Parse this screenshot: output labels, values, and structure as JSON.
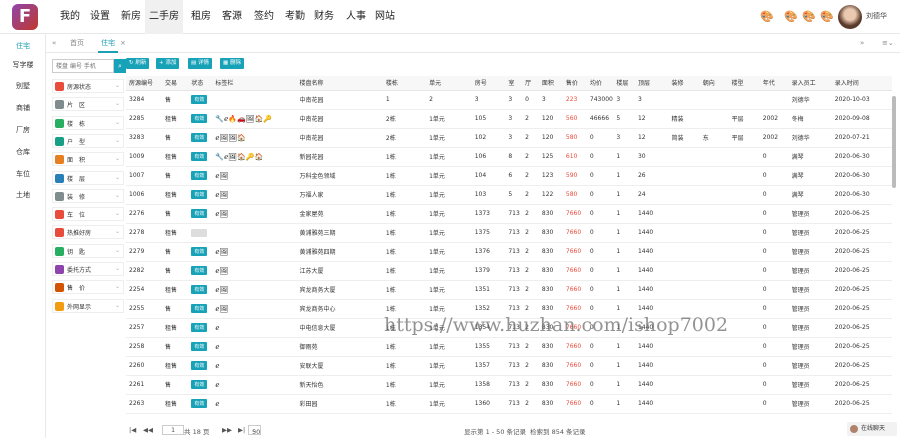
{
  "nav": {
    "logo": "F",
    "items": [
      "我的",
      "设置",
      "新房",
      "二手房",
      "租房",
      "客源",
      "签约",
      "考勤",
      "财务",
      "人事",
      "网站"
    ],
    "active_index": 3,
    "user": "刘德华"
  },
  "leftmenu": {
    "items": [
      "住宅",
      "写字楼",
      "别墅",
      "商铺",
      "厂房",
      "仓库",
      "车位",
      "土地"
    ],
    "active_index": 0
  },
  "tabs": {
    "first": "首页",
    "active": "住宅"
  },
  "filter": {
    "search_placeholder": "楼盘 编号 手机",
    "rows": [
      {
        "label": "房源状态",
        "color": "#e74c3c"
      },
      {
        "label": "片　区",
        "color": "#7f8c8d"
      },
      {
        "label": "楼　栋",
        "color": "#27ae60"
      },
      {
        "label": "户　型",
        "color": "#16a085"
      },
      {
        "label": "面　积",
        "color": "#e67e22"
      },
      {
        "label": "楼　层",
        "color": "#2980b9"
      },
      {
        "label": "装　修",
        "color": "#7f8c8d"
      },
      {
        "label": "车　位",
        "color": "#e74c3c"
      },
      {
        "label": "热推好房",
        "color": "#e74c3c"
      },
      {
        "label": "钥　匙",
        "color": "#27ae60"
      },
      {
        "label": "委托方式",
        "color": "#8e44ad"
      },
      {
        "label": "售　价",
        "color": "#d35400"
      },
      {
        "label": "外网显示",
        "color": "#f39c12"
      }
    ]
  },
  "toolbar": {
    "buttons": [
      "刷新",
      "添加",
      "详情",
      "删除"
    ]
  },
  "table": {
    "headers": [
      "房源编号",
      "交易",
      "状态",
      "标签栏",
      "楼盘名称",
      "楼栋",
      "单元",
      "房号",
      "室",
      "厅",
      "面积",
      "售价",
      "均价",
      "楼层",
      "顶层",
      "装修",
      "朝向",
      "楼型",
      "年代",
      "录入员工",
      "录入时间"
    ],
    "rows": [
      [
        "3284",
        "售",
        "有效",
        "",
        "中南花园",
        "1",
        "2",
        "3",
        "3",
        "0",
        "3",
        "223",
        "743000",
        "3",
        "3",
        "",
        "",
        "",
        "",
        "刘德华",
        "2020-10-03"
      ],
      [
        "2285",
        "租售",
        "有效",
        "🔧ℯ🔥🚗🖼🏠🔑",
        "中南花园",
        "2栋",
        "1单元",
        "105",
        "3",
        "2",
        "120",
        "560",
        "46666",
        "5",
        "12",
        "精装",
        "",
        "平层",
        "2002",
        "冬梅",
        "2020-09-08"
      ],
      [
        "3283",
        "售",
        "有效",
        "ℯ🖼🖼🏠",
        "中南花园",
        "2栋",
        "1单元",
        "102",
        "3",
        "2",
        "120",
        "580",
        "0",
        "3",
        "12",
        "简装",
        "东",
        "平层",
        "2002",
        "刘德华",
        "2020-07-21"
      ],
      [
        "1009",
        "租售",
        "有效",
        "🔧ℯ🖼🏠🔑🏠",
        "新园花园",
        "1栋",
        "1单元",
        "106",
        "8",
        "2",
        "125",
        "610",
        "0",
        "1",
        "30",
        "",
        "",
        "",
        "0",
        "满琴",
        "2020-06-30"
      ],
      [
        "1007",
        "售",
        "有效",
        "ℯ🖼",
        "万科金色领域",
        "1栋",
        "1单元",
        "104",
        "6",
        "2",
        "123",
        "590",
        "0",
        "1",
        "26",
        "",
        "",
        "",
        "0",
        "满琴",
        "2020-06-30"
      ],
      [
        "1006",
        "租售",
        "有效",
        "ℯ🖼",
        "万福人家",
        "1栋",
        "1单元",
        "103",
        "5",
        "2",
        "122",
        "580",
        "0",
        "1",
        "24",
        "",
        "",
        "",
        "0",
        "满琴",
        "2020-06-30"
      ],
      [
        "2276",
        "售",
        "有效",
        "ℯ🖼",
        "金家屋苑",
        "1栋",
        "1单元",
        "1373",
        "713",
        "2",
        "830",
        "7660",
        "0",
        "1",
        "1440",
        "",
        "",
        "",
        "0",
        "管理员",
        "2020-06-25"
      ],
      [
        "2278",
        "租售",
        "",
        "",
        "黄浦雅苑三期",
        "1栋",
        "1单元",
        "1375",
        "713",
        "2",
        "830",
        "7660",
        "0",
        "1",
        "1440",
        "",
        "",
        "",
        "0",
        "管理员",
        "2020-06-25"
      ],
      [
        "2279",
        "售",
        "有效",
        "ℯ🖼",
        "黄浦雅苑四期",
        "1栋",
        "1单元",
        "1376",
        "713",
        "2",
        "830",
        "7660",
        "0",
        "1",
        "1440",
        "",
        "",
        "",
        "0",
        "管理员",
        "2020-06-25"
      ],
      [
        "2282",
        "售",
        "有效",
        "ℯ🖼",
        "江苏大厦",
        "1栋",
        "1单元",
        "1379",
        "713",
        "2",
        "830",
        "7660",
        "0",
        "1",
        "1440",
        "",
        "",
        "",
        "0",
        "管理员",
        "2020-06-25"
      ],
      [
        "2254",
        "租售",
        "有效",
        "ℯ🖼",
        "宾龙商务大厦",
        "1栋",
        "1单元",
        "1351",
        "713",
        "2",
        "830",
        "7660",
        "0",
        "1",
        "1440",
        "",
        "",
        "",
        "0",
        "管理员",
        "2020-06-25"
      ],
      [
        "2255",
        "售",
        "有效",
        "ℯ🖼",
        "宾龙商务中心",
        "1栋",
        "1单元",
        "1352",
        "713",
        "2",
        "830",
        "7660",
        "0",
        "1",
        "1440",
        "",
        "",
        "",
        "0",
        "管理员",
        "2020-06-25"
      ],
      [
        "2257",
        "租售",
        "有效",
        "ℯ",
        "中电信息大厦",
        "1栋",
        "1单元",
        "1354",
        "713",
        "2",
        "830",
        "7660",
        "0",
        "1",
        "1440",
        "",
        "",
        "",
        "0",
        "管理员",
        "2020-06-25"
      ],
      [
        "2258",
        "售",
        "有效",
        "ℯ",
        "御雨苑",
        "1栋",
        "1单元",
        "1355",
        "713",
        "2",
        "830",
        "7660",
        "0",
        "1",
        "1440",
        "",
        "",
        "",
        "0",
        "管理员",
        "2020-06-25"
      ],
      [
        "2260",
        "租售",
        "有效",
        "ℯ",
        "安联大厦",
        "1栋",
        "1单元",
        "1357",
        "713",
        "2",
        "830",
        "7660",
        "0",
        "1",
        "1440",
        "",
        "",
        "",
        "0",
        "管理员",
        "2020-06-25"
      ],
      [
        "2261",
        "售",
        "有效",
        "ℯ",
        "新天怡色",
        "1栋",
        "1单元",
        "1358",
        "713",
        "2",
        "830",
        "7660",
        "0",
        "1",
        "1440",
        "",
        "",
        "",
        "0",
        "管理员",
        "2020-06-25"
      ],
      [
        "2263",
        "租售",
        "有效",
        "ℯ",
        "彩田园",
        "1栋",
        "1单元",
        "1360",
        "713",
        "2",
        "830",
        "7660",
        "0",
        "1",
        "1440",
        "",
        "",
        "",
        "0",
        "管理员",
        "2020-06-25"
      ]
    ]
  },
  "pager": {
    "page": "1",
    "total_pages": "共 18 页",
    "page_size": "50",
    "range": "显示第 1 - 50 条记录",
    "total": "检索到 854 条记录"
  },
  "watermark": "https://www.huzhan.com/ishop7002",
  "chat": "在线聊天"
}
